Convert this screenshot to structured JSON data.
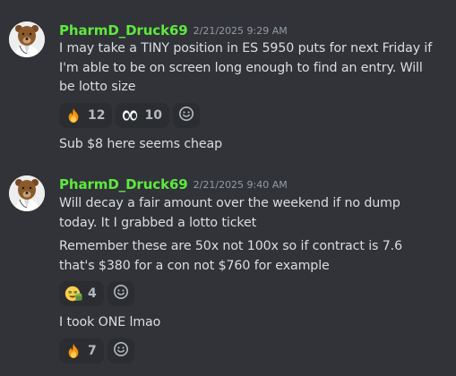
{
  "messages": [
    {
      "username": "PharmD_Druck69",
      "timestamp": "2/21/2025 9:29 AM",
      "lines": [
        "I may take a TINY position in ES 5950 puts for next Friday if I'm able to be on screen long enough to find an entry. Will be lotto size"
      ],
      "reactions": [
        {
          "emoji": "fire-icon",
          "count": "12"
        },
        {
          "emoji": "eyes-icon",
          "count": "10"
        }
      ],
      "followup": "Sub $8 here seems cheap"
    },
    {
      "username": "PharmD_Druck69",
      "timestamp": "2/21/2025 9:40 AM",
      "lines": [
        "Will decay a fair amount over the weekend if no dump today. It I grabbed a lotto ticket",
        "Remember these are 50x not 100x so if contract is 7.6 that's $380 for a con not $760 for example"
      ],
      "reactions": [
        {
          "emoji": "money-face-icon",
          "count": "4"
        }
      ],
      "followup": "I took ONE lmao",
      "followup_reactions": [
        {
          "emoji": "fire-icon",
          "count": "7"
        }
      ]
    }
  ],
  "colors": {
    "background": "#313338",
    "username": "#5ee83f",
    "timestamp": "#949ba4",
    "text": "#dbdee1",
    "reaction_bg": "#2b2d31"
  }
}
